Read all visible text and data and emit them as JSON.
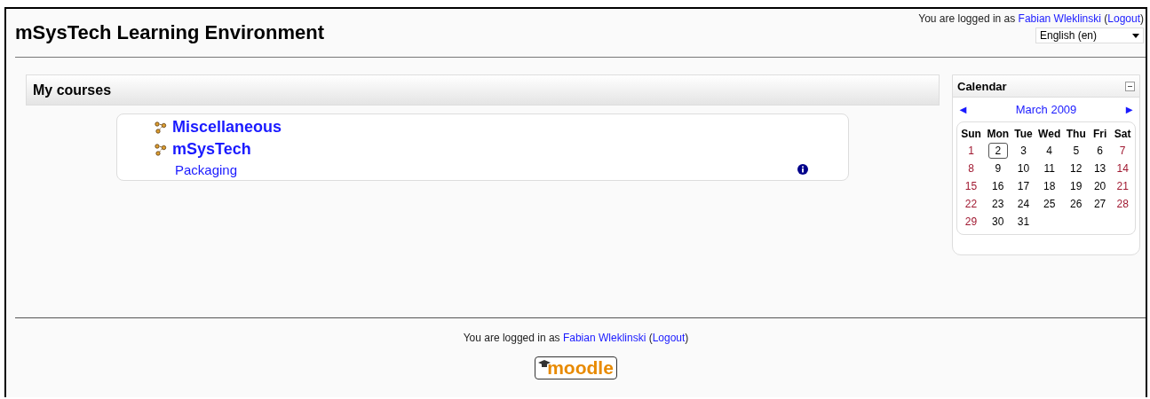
{
  "site_title": "mSysTech Learning Environment",
  "login_header": {
    "prefix": "You are logged in as",
    "user": "Fabian Wleklinski",
    "logout_open": "(",
    "logout": "Logout",
    "logout_close": ")"
  },
  "language": {
    "value": "English (en)"
  },
  "my_courses": {
    "title": "My courses",
    "categories": [
      {
        "name": "Miscellaneous"
      },
      {
        "name": "mSysTech",
        "children": [
          {
            "name": "Packaging",
            "info": true
          }
        ]
      }
    ]
  },
  "calendar": {
    "title": "Calendar",
    "prev": "◄",
    "next": "►",
    "month": "March 2009",
    "weekdays": [
      "Sun",
      "Mon",
      "Tue",
      "Wed",
      "Thu",
      "Fri",
      "Sat"
    ],
    "weeks": [
      [
        {
          "day": "1",
          "selected": false
        },
        {
          "day": "2",
          "selected": true
        },
        {
          "day": "3",
          "selected": false
        },
        {
          "day": "4",
          "selected": false
        },
        {
          "day": "5",
          "selected": false
        },
        {
          "day": "6",
          "selected": false
        },
        {
          "day": "7",
          "selected": false
        }
      ],
      [
        {
          "day": "8",
          "selected": false
        },
        {
          "day": "9",
          "selected": false
        },
        {
          "day": "10",
          "selected": false
        },
        {
          "day": "11",
          "selected": false
        },
        {
          "day": "12",
          "selected": false
        },
        {
          "day": "13",
          "selected": false
        },
        {
          "day": "14",
          "selected": false
        }
      ],
      [
        {
          "day": "15",
          "selected": false
        },
        {
          "day": "16",
          "selected": false
        },
        {
          "day": "17",
          "selected": false
        },
        {
          "day": "18",
          "selected": false
        },
        {
          "day": "19",
          "selected": false
        },
        {
          "day": "20",
          "selected": false
        },
        {
          "day": "21",
          "selected": false
        }
      ],
      [
        {
          "day": "22",
          "selected": false
        },
        {
          "day": "23",
          "selected": false
        },
        {
          "day": "24",
          "selected": false
        },
        {
          "day": "25",
          "selected": false
        },
        {
          "day": "26",
          "selected": false
        },
        {
          "day": "27",
          "selected": false
        },
        {
          "day": "28",
          "selected": false
        }
      ],
      [
        {
          "day": "29",
          "selected": false
        },
        {
          "day": "30",
          "selected": false
        },
        {
          "day": "31",
          "selected": false
        }
      ]
    ]
  },
  "login_footer": {
    "prefix": "You are logged in as",
    "user": "Fabian Wleklinski",
    "logout_open": "(",
    "logout": "Logout",
    "logout_close": ")"
  },
  "logo": {
    "text": "moodle"
  }
}
